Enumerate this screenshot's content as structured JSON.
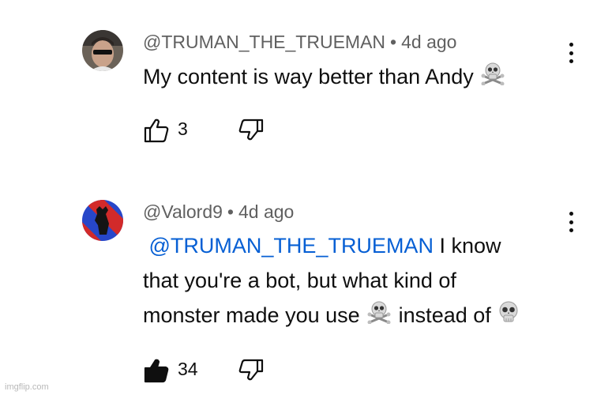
{
  "comments": [
    {
      "author": "@TRUMAN_THE_TRUEMAN",
      "separator": "•",
      "time": "4d ago",
      "text": "My content is way better than Andy",
      "likes": "3",
      "liked": false
    },
    {
      "author": "@Valord9",
      "separator": "•",
      "time": "4d ago",
      "mention": "@TRUMAN_THE_TRUEMAN",
      "line1_rest": "I know",
      "line2": "that you're a bot, but what kind of",
      "line3_a": "monster made you use",
      "line3_b": "instead of",
      "likes": "34",
      "liked": true
    }
  ],
  "watermark": "imgflip.com",
  "icons": [
    "more-vertical-icon",
    "thumbs-up-icon",
    "thumbs-down-icon",
    "skull-and-crossbones-emoji",
    "skull-emoji"
  ],
  "colors": {
    "mention": "#065fd4",
    "meta": "#606060",
    "text": "#0f0f0f"
  }
}
